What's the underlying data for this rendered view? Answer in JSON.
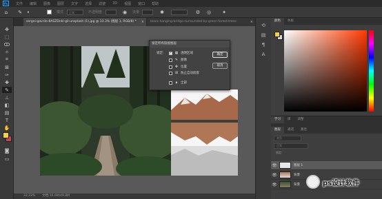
{
  "app": {
    "logo_text": "Ps"
  },
  "menu": [
    "文件",
    "编辑",
    "图像",
    "图层",
    "文字",
    "选择",
    "滤镜",
    "3D",
    "视图",
    "窗口",
    "帮助"
  ],
  "options_bar": {
    "mode_label": "模式",
    "mode_value": "正常",
    "opacity_label": "不透明度",
    "flow_label": "流量"
  },
  "tabs": [
    {
      "label": "sergei-gavrilo-8ASZDnkl-gil-unsplash (1).jpg @ 33.3% (图层 1, RGB/8) *",
      "close": "×"
    },
    {
      "label": "black-hanging-bridge-surrounded-by-green-forest-trees-",
      "close": "×"
    }
  ],
  "dialog": {
    "title": "锁定所有链接图层",
    "lock_label": "锁定:",
    "options": [
      {
        "label": "透明区域",
        "checked": true,
        "icon": "checker-icon"
      },
      {
        "label": "图像",
        "checked": false,
        "icon": "brush-icon"
      },
      {
        "label": "位置",
        "checked": false,
        "icon": "move-icon"
      },
      {
        "label": "防止自动嵌套",
        "checked": false,
        "icon": "artboard-icon"
      },
      {
        "label": "全部",
        "checked": false,
        "icon": "lock-icon"
      }
    ],
    "ok_label": "确定",
    "cancel_label": "取消"
  },
  "status": {
    "zoom": "33.33%",
    "doc_info": "文档:16.6M/49.8M"
  },
  "color_panel": {
    "tabs": [
      "颜色",
      "色板"
    ],
    "fg_color": "#f2d43b",
    "bg_color": "#d9d9d9"
  },
  "learn_panel": {
    "tabs": [
      "学习",
      "库",
      "调整"
    ]
  },
  "layers_panel": {
    "tabs": [
      "图层",
      "通道",
      "路径"
    ],
    "filter_placeholder": "类型",
    "blend_mode": "正常",
    "lock_label": "锁定:",
    "layers": [
      {
        "name": "图层 1",
        "selected": true
      },
      {
        "name": "背景",
        "selected": false
      },
      {
        "name": "背景",
        "selected": false
      }
    ]
  },
  "watermark": {
    "text": "ps设计软件"
  },
  "toolbar": {
    "fg_color": "#f2d43b",
    "bg_color": "#c8434b"
  }
}
